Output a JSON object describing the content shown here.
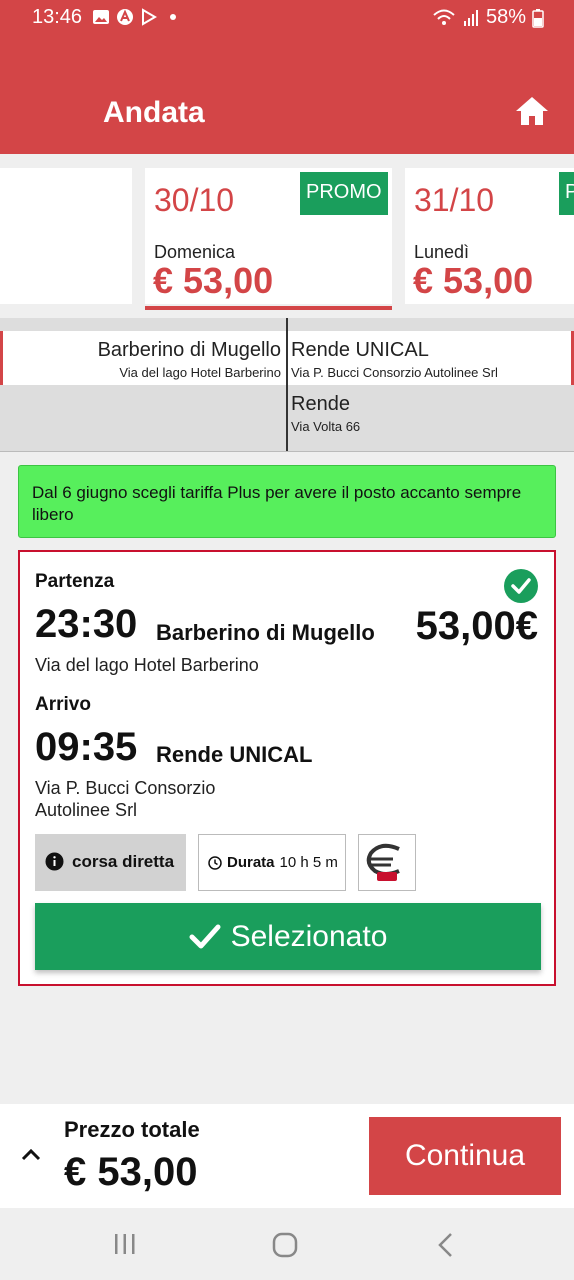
{
  "status": {
    "time": "13:46",
    "battery": "58%"
  },
  "header": {
    "title": "Andata"
  },
  "date_cards": [
    {
      "date": "30/10",
      "day": "Domenica",
      "price": "€ 53,00",
      "promo": "PROMO",
      "selected": true
    },
    {
      "date": "31/10",
      "day": "Lunedì",
      "price": "€ 53,00",
      "promo": "P",
      "selected": false
    }
  ],
  "stops": {
    "origin": {
      "name": "Barberino di Mugello",
      "address": "Via del lago Hotel Barberino"
    },
    "destinations": [
      {
        "name": "Rende UNICAL",
        "address": "Via P. Bucci Consorzio Autolinee Srl"
      },
      {
        "name": "Rende",
        "address": "Via Volta 66"
      }
    ]
  },
  "banner": {
    "text": "Dal 6 giugno  scegli tariffa Plus per avere il posto accanto sempre libero"
  },
  "trip": {
    "departure_label": "Partenza",
    "departure_time": "23:30",
    "departure_place": "Barberino di Mugello",
    "departure_address": "Via del lago Hotel Barberino",
    "price": "53,00€",
    "arrival_label": "Arrivo",
    "arrival_time": "09:35",
    "arrival_place": "Rende UNICAL",
    "arrival_address_line1": "Via P. Bucci Consorzio",
    "arrival_address_line2": "Autolinee Srl",
    "direct_label": "corsa diretta",
    "duration_label": "Durata",
    "duration_value": "10 h 5 m",
    "selected_label": "Selezionato"
  },
  "footer": {
    "total_label": "Prezzo totale",
    "total_value": "€ 53,00",
    "continue_label": "Continua"
  },
  "colors": {
    "brand_red": "#d34547",
    "green": "#1a9e5c",
    "banner_green": "#57ef5c",
    "card_border": "#c8102e"
  },
  "icons": [
    "home-icon",
    "check-circle-icon",
    "info-icon",
    "clock-icon",
    "operator-logo",
    "chevron-up-icon",
    "checkmark-icon"
  ]
}
